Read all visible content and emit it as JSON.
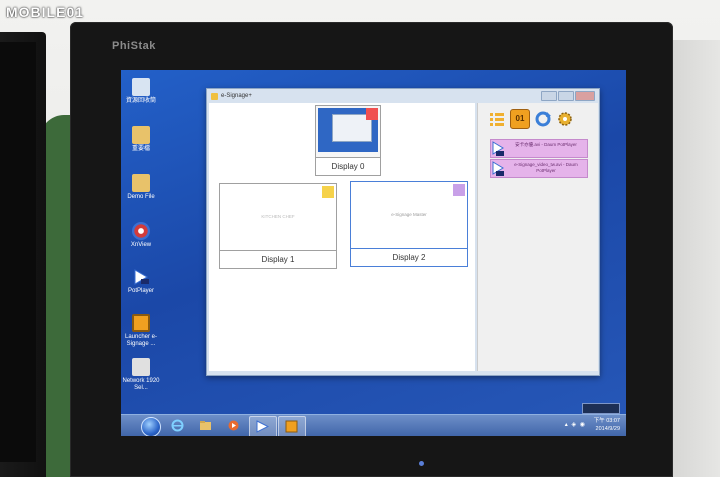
{
  "watermark": "MOBILE01",
  "monitor": {
    "brand": "PhiStak"
  },
  "desktop": {
    "icons": [
      {
        "name": "recycle-bin",
        "label": "資源回收筒",
        "color": "#d8e4f2"
      },
      {
        "name": "folder",
        "label": "重要檔",
        "color": "#e8c26a"
      },
      {
        "name": "demo-file",
        "label": "Demo File",
        "color": "#e8c26a"
      },
      {
        "name": "xnview",
        "label": "XnView",
        "color": "#d23b3b"
      },
      {
        "name": "potplayer",
        "label": "PotPlayer",
        "color": "#ffffff"
      },
      {
        "name": "launcher",
        "label": "Launcher e-Signage ...",
        "color": "#f0a020"
      },
      {
        "name": "shortcut",
        "label": "Network 1920 Sel...",
        "color": "#e0e0e0"
      }
    ]
  },
  "app": {
    "title": "e-Signage+",
    "displays": [
      {
        "label": "Display 0",
        "accent": "#f05050",
        "preview": ""
      },
      {
        "label": "Display 1",
        "accent": "#f6d24a",
        "preview": "KITCHEN CHEF"
      },
      {
        "label": "Display 2",
        "accent": "#c8a0e8",
        "preview": "e-Signage Master"
      }
    ],
    "toolbar": {
      "calendar_day": "01"
    },
    "playlist": [
      {
        "label": "安卡亦優.avi - Daum PotPlayer"
      },
      {
        "label": "e-Signage_video_tw.avi - Daum PotPlayer"
      }
    ]
  },
  "taskbar": {
    "time": "下午 03:07",
    "date": "2014/9/29"
  }
}
